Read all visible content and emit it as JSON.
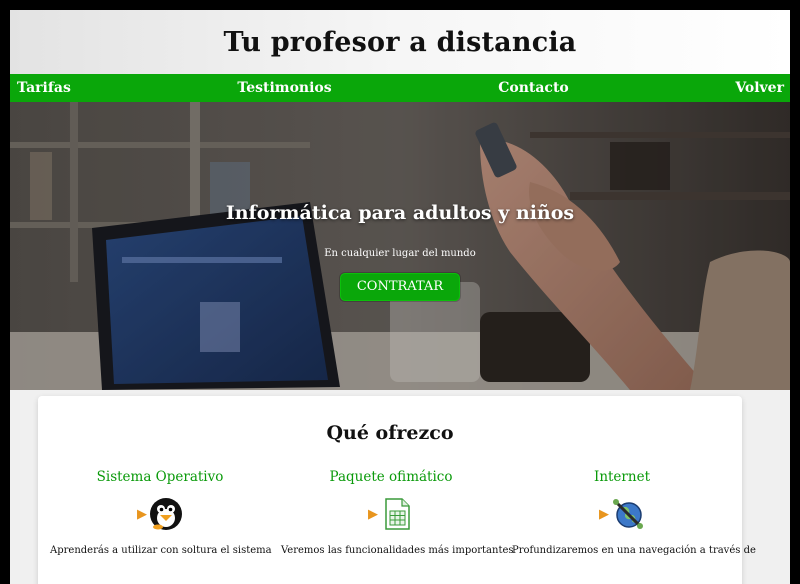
{
  "header": {
    "title": "Tu profesor a distancia"
  },
  "nav": {
    "items": [
      "Tarifas",
      "Testimonios",
      "Contacto",
      "Volver"
    ]
  },
  "hero": {
    "title": "Informática para adultos y niños",
    "subtitle": "En cualquier lugar del mundo",
    "button_label": "CONTRATAR"
  },
  "offer": {
    "title": "Qué ofrezco",
    "items": [
      {
        "title": "Sistema Operativo",
        "icon": "penguin-icon",
        "text": "Aprenderás a utilizar con soltura el sistema"
      },
      {
        "title": "Paquete ofimático",
        "icon": "spreadsheet-icon",
        "text": "Veremos las funcionalidades más importantes"
      },
      {
        "title": "Internet",
        "icon": "globe-icon",
        "text": "Profundizaremos en una navegación a través de"
      }
    ]
  },
  "colors": {
    "accent": "#0aa70a",
    "arrow": "#e8951e",
    "link": "#0a9a0a"
  }
}
